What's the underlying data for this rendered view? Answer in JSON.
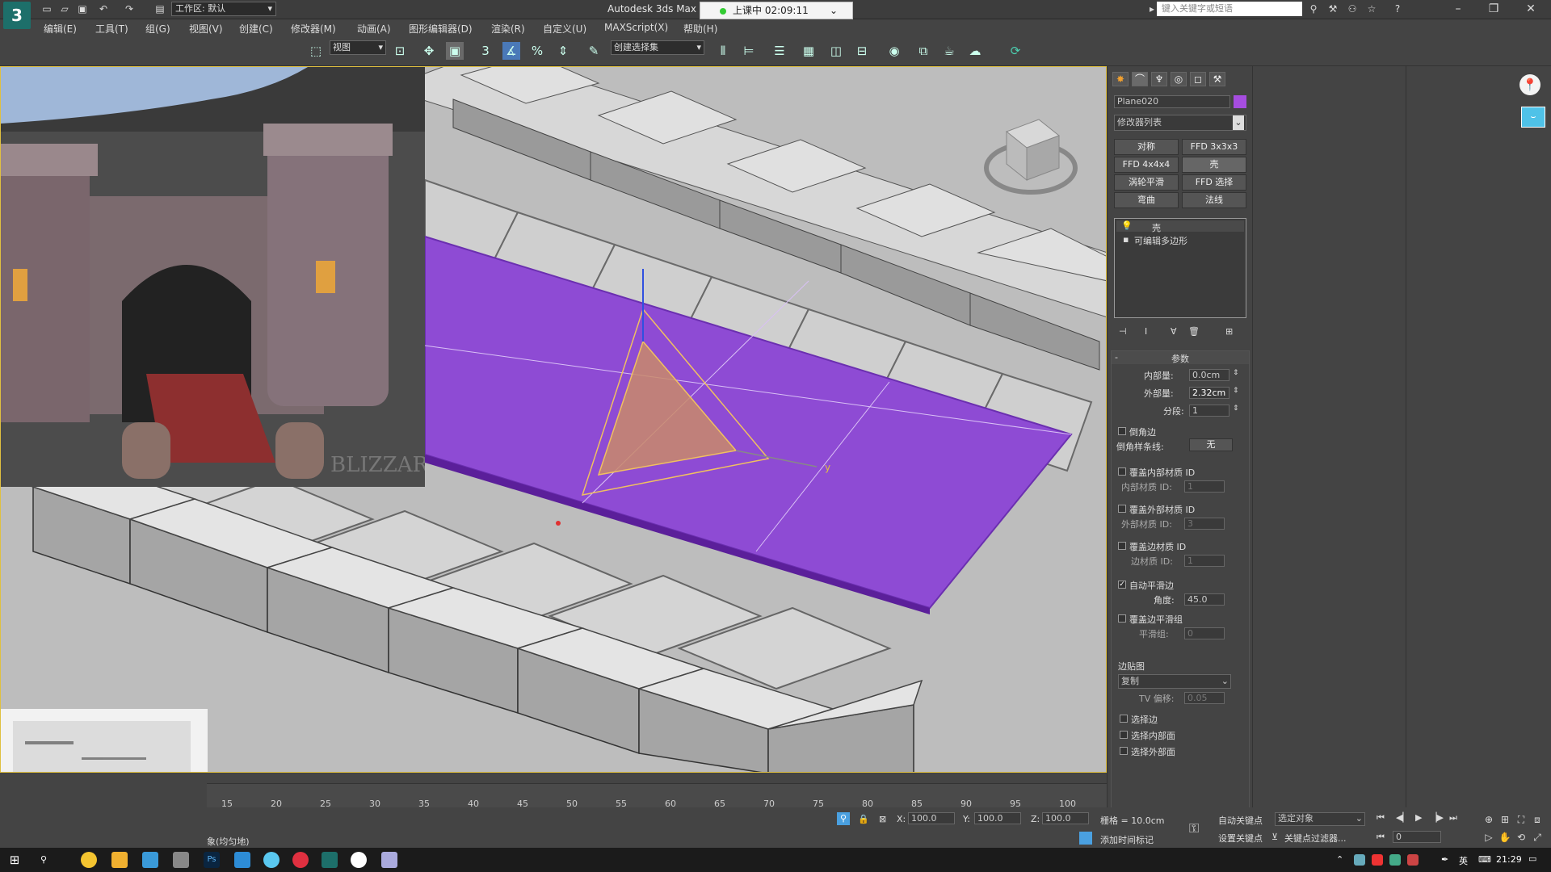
{
  "app": {
    "title": "Autodesk 3ds Max",
    "workspace": "工作区: 默认",
    "timer": "上课中 02:09:11",
    "search_placeholder": "键入关键字或短语"
  },
  "menu": [
    "编辑(E)",
    "工具(T)",
    "组(G)",
    "视图(V)",
    "创建(C)",
    "修改器(M)",
    "动画(A)",
    "图形编辑器(D)",
    "渲染(R)",
    "自定义(U)",
    "MAXScript(X)",
    "帮助(H)"
  ],
  "toolbar": {
    "view_select": "视图",
    "selection_set": "创建选择集",
    "snap_value": "3"
  },
  "viewport": {
    "watermark": "BLIZZARD",
    "gizmo_axis": "y",
    "plane_color": "#8e4bd4",
    "border_color": "#e0c040"
  },
  "timeline": {
    "ticks": [
      "15",
      "20",
      "25",
      "30",
      "35",
      "40",
      "45",
      "50",
      "55",
      "60",
      "65",
      "70",
      "75",
      "80",
      "85",
      "90",
      "95",
      "100"
    ]
  },
  "status": {
    "prompt": "象(均匀地)",
    "x_label": "X:",
    "x_value": "100.0",
    "y_label": "Y:",
    "y_value": "100.0",
    "z_label": "Z:",
    "z_value": "100.0",
    "grid": "栅格 = 10.0cm",
    "add_tag": "添加时间标记",
    "auto_key": "自动关键点",
    "set_key": "设置关键点",
    "key_filter": "关键点过滤器...",
    "selected_object": "选定对象",
    "frame": "0"
  },
  "command_panel": {
    "object_name": "Plane020",
    "object_color": "#a64de0",
    "modifier_list": "修改器列表",
    "modifier_buttons": [
      "对称",
      "FFD 3x3x3",
      "FFD 4x4x4",
      "壳",
      "涡轮平滑",
      "FFD 选择",
      "弯曲",
      "法线"
    ],
    "stack": [
      {
        "label": "壳",
        "icon": "lightbulb-icon"
      },
      {
        "label": "可编辑多边形",
        "icon": "expand-icon"
      }
    ],
    "rollout_title": "参数",
    "params": {
      "inner_label": "内部量:",
      "inner_value": "0.0cm",
      "outer_label": "外部量:",
      "outer_value": "2.32cm",
      "segments_label": "分段:",
      "segments_value": "1",
      "bevel_edges": "倒角边",
      "bevel_spline_label": "倒角样条线:",
      "bevel_spline_value": "无",
      "override_inner_mat": "覆盖内部材质 ID",
      "inner_mat_label": "内部材质 ID:",
      "inner_mat_value": "1",
      "override_outer_mat": "覆盖外部材质 ID",
      "outer_mat_label": "外部材质 ID:",
      "outer_mat_value": "3",
      "override_edge_mat": "覆盖边材质 ID",
      "edge_mat_label": "边材质 ID:",
      "edge_mat_value": "1",
      "auto_smooth": "自动平滑边",
      "angle_label": "角度:",
      "angle_value": "45.0",
      "override_smooth": "覆盖边平滑组",
      "smooth_group_label": "平滑组:",
      "smooth_group_value": "0",
      "edge_map_title": "边贴图",
      "edge_map_value": "复制",
      "tv_offset_label": "TV 偏移:",
      "tv_offset_value": "0.05",
      "select_edges": "选择边",
      "select_inner": "选择内部面",
      "select_outer": "选择外部面"
    },
    "checkbox_states": {
      "bevel_edges": false,
      "override_inner_mat": false,
      "override_outer_mat": false,
      "override_edge_mat": false,
      "auto_smooth": true,
      "override_smooth": false,
      "select_edges": false,
      "select_inner": false,
      "select_outer": false
    }
  },
  "taskbar": {
    "time": "21:29",
    "lang": "英"
  }
}
